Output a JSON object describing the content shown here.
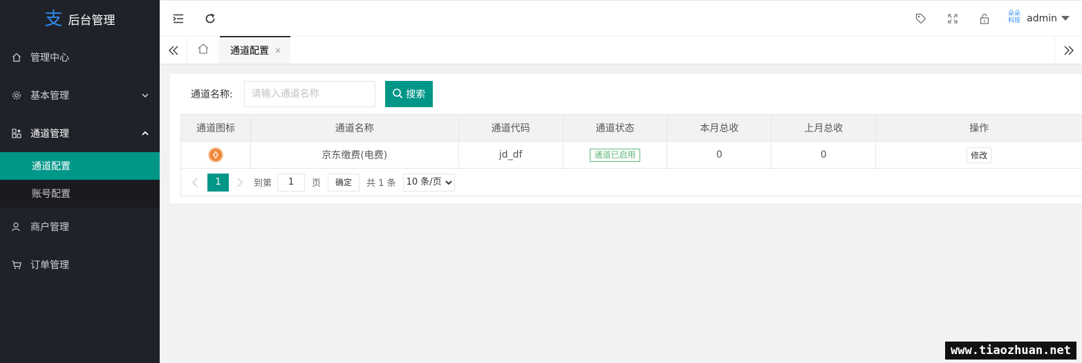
{
  "app": {
    "logo_glyph": "支",
    "title": "后台管理",
    "accent": "#009688",
    "sidebar_bg": "#20222a"
  },
  "sidebar": {
    "items": [
      {
        "label": "管理中心",
        "icon": "home-icon"
      },
      {
        "label": "基本管理",
        "icon": "gear-icon"
      },
      {
        "label": "通道管理",
        "icon": "apps-icon",
        "expanded": true,
        "children": [
          {
            "label": "通道配置",
            "active": true
          },
          {
            "label": "账号配置"
          }
        ]
      },
      {
        "label": "商户管理",
        "icon": "user-icon"
      },
      {
        "label": "订单管理",
        "icon": "cart-icon"
      }
    ]
  },
  "header": {
    "user_avatar_text": "朵朵科技",
    "username": "admin"
  },
  "tabs": {
    "active_label": "通道配置",
    "close_glyph": "×"
  },
  "search": {
    "label": "通道名称:",
    "placeholder": "请输入通道名称",
    "button_label": "搜索"
  },
  "table": {
    "columns": [
      "通道图标",
      "通道名称",
      "通道代码",
      "通道状态",
      "本月总收",
      "上月总收",
      "操作"
    ],
    "rows": [
      {
        "name": "京东缴费(电费)",
        "code": "jd_df",
        "status": "通道已启用",
        "this_month": "0",
        "last_month": "0",
        "action": "修改"
      }
    ]
  },
  "pager": {
    "current_page": "1",
    "goto_label": "到第",
    "goto_value": "1",
    "page_unit": "页",
    "confirm_label": "确定",
    "total_text": "共 1 条",
    "page_size_option": "10 条/页"
  },
  "watermark": "www.tiaozhuan.net"
}
